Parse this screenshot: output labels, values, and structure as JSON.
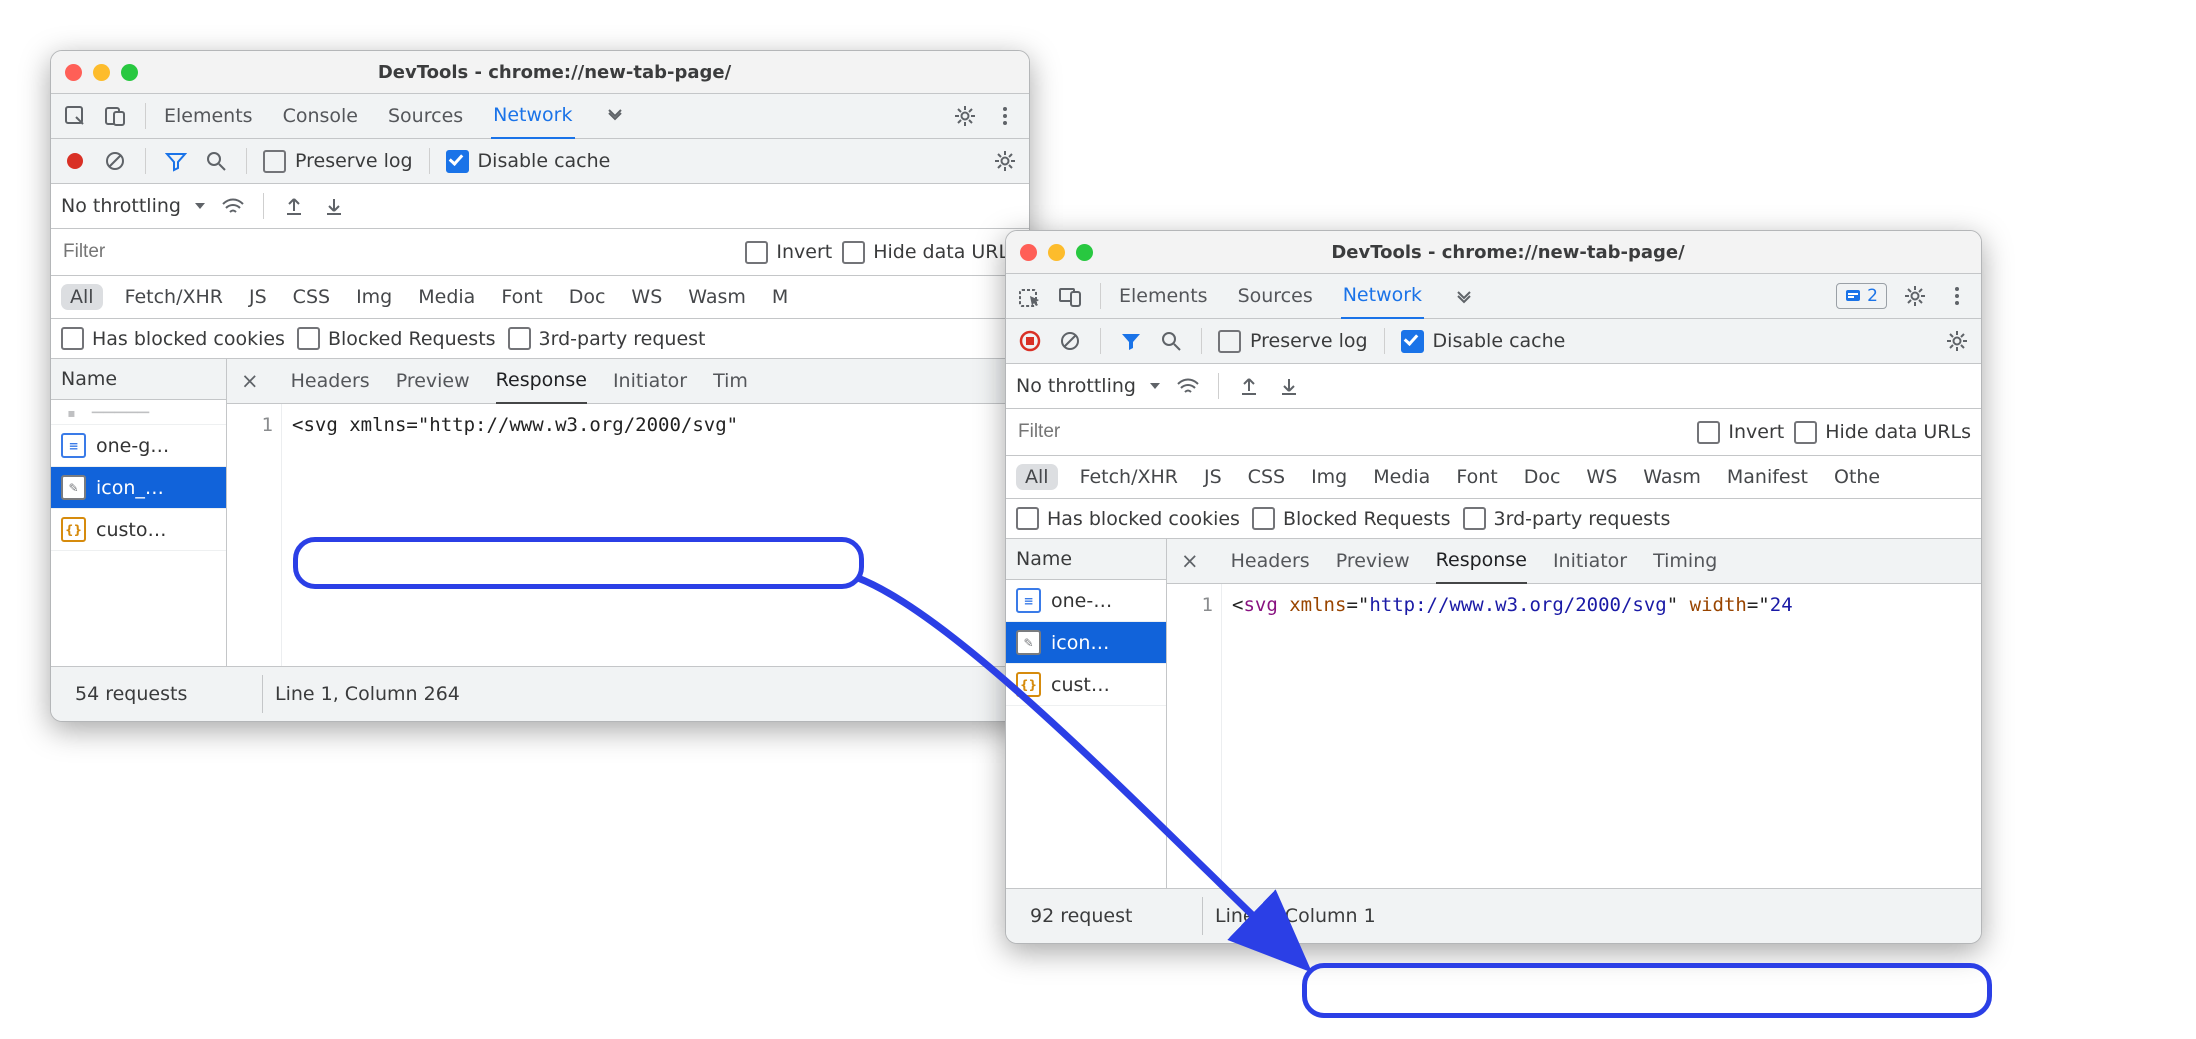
{
  "win1": {
    "title": "DevTools - chrome://new-tab-page/",
    "tabs": [
      "Elements",
      "Console",
      "Sources",
      "Network"
    ],
    "active_tab": "Network",
    "toolbar": {
      "preserve": "Preserve log",
      "disable_cache": "Disable cache"
    },
    "throttle": "No throttling",
    "filter_placeholder": "Filter",
    "filter_opts": {
      "invert": "Invert",
      "hide": "Hide data URLs"
    },
    "cats": [
      "All",
      "Fetch/XHR",
      "JS",
      "CSS",
      "Img",
      "Media",
      "Font",
      "Doc",
      "WS",
      "Wasm",
      "M"
    ],
    "opts": {
      "a": "Has blocked cookies",
      "b": "Blocked Requests",
      "c": "3rd-party request"
    },
    "name_hdr": "Name",
    "items": [
      {
        "kind": "doc",
        "label": "one-g…"
      },
      {
        "kind": "img",
        "label": "icon_…"
      },
      {
        "kind": "js",
        "label": "custo…"
      }
    ],
    "sel_idx": 1,
    "detabs": [
      "Headers",
      "Preview",
      "Response",
      "Initiator",
      "Tim"
    ],
    "active_de": "Response",
    "line_no": "1",
    "code_text": "<svg xmlns=\"http://www.w3.org/2000/svg\"",
    "status_left": "54 requests",
    "status_right": "Line 1, Column 264"
  },
  "win2": {
    "title": "DevTools - chrome://new-tab-page/",
    "tabs": [
      "Elements",
      "Sources",
      "Network"
    ],
    "active_tab": "Network",
    "issues": "2",
    "toolbar": {
      "preserve": "Preserve log",
      "disable_cache": "Disable cache"
    },
    "throttle": "No throttling",
    "filter_placeholder": "Filter",
    "filter_opts": {
      "invert": "Invert",
      "hide": "Hide data URLs"
    },
    "cats": [
      "All",
      "Fetch/XHR",
      "JS",
      "CSS",
      "Img",
      "Media",
      "Font",
      "Doc",
      "WS",
      "Wasm",
      "Manifest",
      "Othe"
    ],
    "opts": {
      "a": "Has blocked cookies",
      "b": "Blocked Requests",
      "c": "3rd-party requests"
    },
    "name_hdr": "Name",
    "items": [
      {
        "kind": "doc",
        "label": "one-…"
      },
      {
        "kind": "img",
        "label": "icon…"
      },
      {
        "kind": "js",
        "label": "cust…"
      }
    ],
    "sel_idx": 1,
    "detabs": [
      "Headers",
      "Preview",
      "Response",
      "Initiator",
      "Timing"
    ],
    "active_de": "Response",
    "line_no": "1",
    "code_text": "<svg xmlns=\"http://www.w3.org/2000/svg\" width=\"24",
    "status_left": "92 request",
    "status_right": "Line 1, Column 1"
  }
}
